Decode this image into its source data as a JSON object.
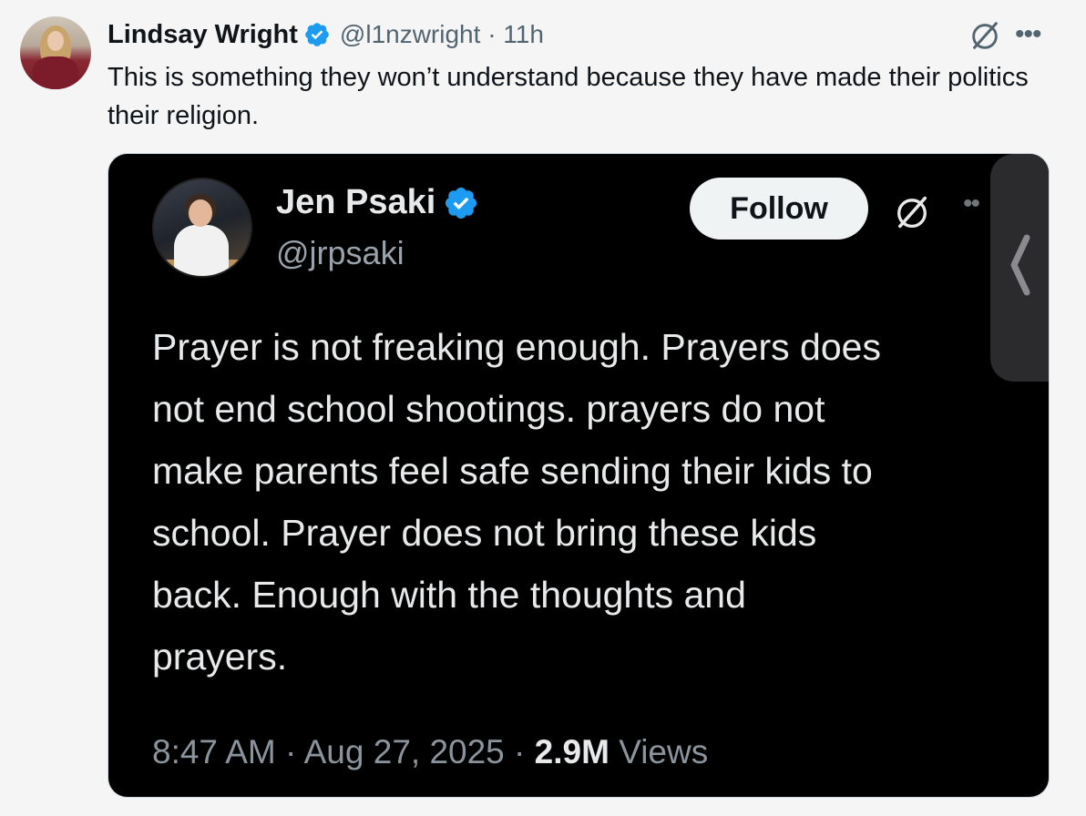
{
  "tweet": {
    "author_name": "Lindsay Wright",
    "handle": "@l1nzwright",
    "separator": "·",
    "time": "11h",
    "text": "This is something they won’t understand because they have made their politics their religion."
  },
  "quoted": {
    "author_name": "Jen Psaki",
    "handle": "@jrpsaki",
    "follow_label": "Follow",
    "text_lines": [
      "Prayer is not freaking enough.  Prayers does",
      "not end school shootings. prayers do not",
      "make parents feel safe sending their kids to",
      "school.  Prayer does not bring these kids",
      "back. Enough with the thoughts and",
      "prayers."
    ],
    "time": "8:47 AM",
    "date": "Aug 27, 2025",
    "views_count": "2.9M",
    "views_label": "Views",
    "separator": "·"
  },
  "icons": {
    "verified": "verified-badge-icon",
    "grok": "grok-icon",
    "more": "more-icon",
    "chevron": "chevron-left-icon"
  },
  "colors": {
    "verified_blue": "#1d9bf0",
    "secondary_text": "#536471"
  }
}
